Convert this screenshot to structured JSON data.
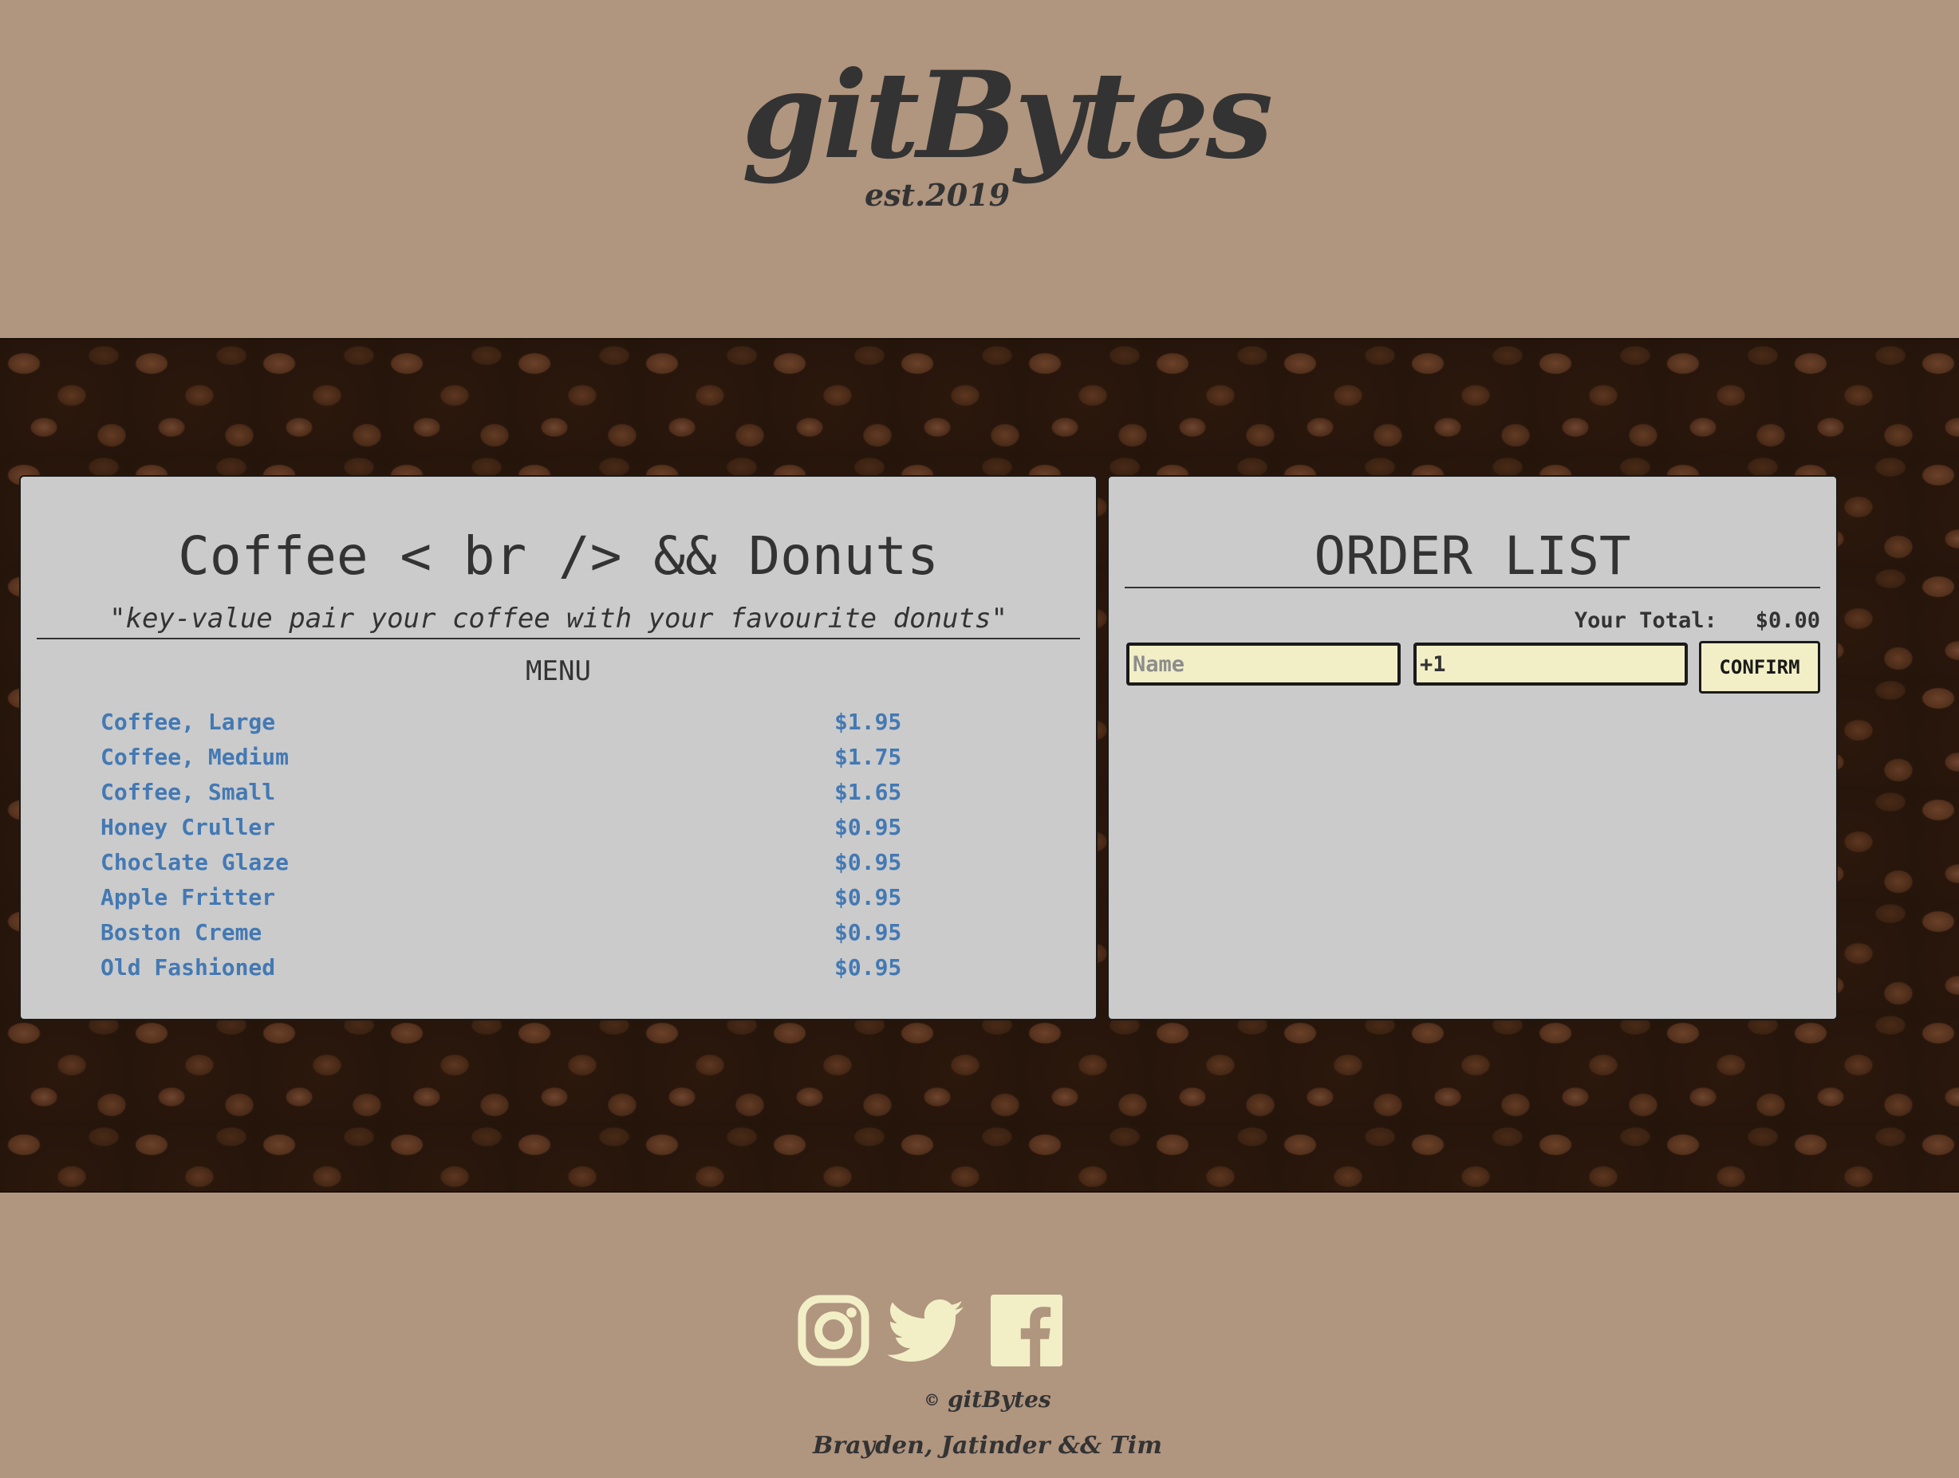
{
  "brand": {
    "name": "gitBytes",
    "established": "est.2019"
  },
  "menu_panel": {
    "title": "Coffee < br /> && Donuts",
    "tagline": "\"key-value pair your coffee with your favourite donuts\"",
    "heading": "MENU",
    "items": [
      {
        "name": "Coffee, Large",
        "price": "$1.95"
      },
      {
        "name": "Coffee, Medium",
        "price": "$1.75"
      },
      {
        "name": "Coffee, Small",
        "price": "$1.65"
      },
      {
        "name": "Honey Cruller",
        "price": "$0.95"
      },
      {
        "name": "Choclate Glaze",
        "price": "$0.95"
      },
      {
        "name": "Apple Fritter",
        "price": "$0.95"
      },
      {
        "name": "Boston Creme",
        "price": "$0.95"
      },
      {
        "name": "Old Fashioned",
        "price": "$0.95"
      }
    ]
  },
  "order_panel": {
    "title": "ORDER LIST",
    "total_label": "Your Total:",
    "total_value": "$0.00",
    "name_placeholder": "Name",
    "name_value": "",
    "quantity_value": "+1",
    "confirm_label": "CONFIRM"
  },
  "footer": {
    "social_icons": [
      "instagram-icon",
      "twitter-icon",
      "facebook-icon"
    ],
    "copyright_mark": "©",
    "copyright_name": "gitBytes",
    "credits": "Brayden, Jatinder && Tim"
  },
  "colors": {
    "background": "#b0957f",
    "panel": "#cbcbcb",
    "text": "#333333",
    "menu_link": "#4379b4",
    "input_fill": "#f2efc7",
    "social_icon": "#f2efc7"
  }
}
